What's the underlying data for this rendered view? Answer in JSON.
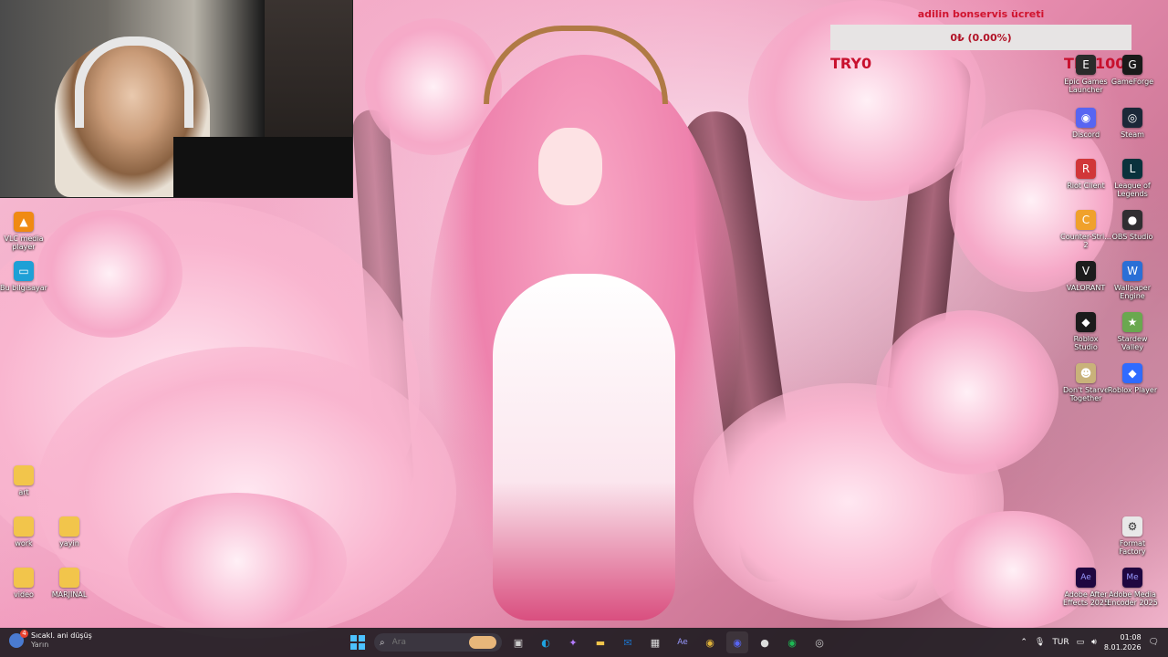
{
  "counter": {
    "title": "adilin bonservis ücreti",
    "value": "0₺ (0.00%)",
    "left_label": "TRY0",
    "right_label": "TRY1000"
  },
  "left_icons": [
    {
      "label": "VLC media\nplayer",
      "icon": "vlc-icon",
      "color": "#f08a12",
      "glyph": "▲"
    },
    {
      "label": "Bu bilgisayar",
      "icon": "computer-icon",
      "color": "#1ea0d6",
      "glyph": "▭"
    },
    {
      "label": "art",
      "icon": "folder-icon",
      "color": "#f2c54b",
      "glyph": ""
    },
    {
      "label": "work",
      "icon": "folder-icon",
      "color": "#f2c54b",
      "glyph": ""
    },
    {
      "label": "yayin",
      "icon": "folder-icon",
      "color": "#f2c54b",
      "glyph": ""
    },
    {
      "label": "video",
      "icon": "folder-icon",
      "color": "#f2c54b",
      "glyph": ""
    },
    {
      "label": "MARJINAL",
      "icon": "folder-icon",
      "color": "#f2c54b",
      "glyph": ""
    }
  ],
  "right_icons": [
    {
      "label": "Epic Games\nLauncher",
      "icon": "epic-games-icon",
      "color": "#2b2b2b",
      "glyph": "E"
    },
    {
      "label": "GameForge",
      "icon": "gameforge-icon",
      "color": "#1a1a1a",
      "glyph": "G"
    },
    {
      "label": "Discord",
      "icon": "discord-icon",
      "color": "#5865f2",
      "glyph": "◉"
    },
    {
      "label": "Steam",
      "icon": "steam-icon",
      "color": "#1b2838",
      "glyph": "◎"
    },
    {
      "label": "Riot Client",
      "icon": "riot-client-icon",
      "color": "#d13639",
      "glyph": "R"
    },
    {
      "label": "League of\nLegends",
      "icon": "league-of-legends-icon",
      "color": "#0a323c",
      "glyph": "L"
    },
    {
      "label": "Counter-Stri...\n2",
      "icon": "counter-strike-icon",
      "color": "#f0a12b",
      "glyph": "C"
    },
    {
      "label": "OBS Studio",
      "icon": "obs-icon",
      "color": "#302e31",
      "glyph": "●"
    },
    {
      "label": "VALORANT",
      "icon": "valorant-icon",
      "color": "#1c1c1c",
      "glyph": "V"
    },
    {
      "label": "Wallpaper\nEngine",
      "icon": "wallpaper-engine-icon",
      "color": "#2a6fd6",
      "glyph": "W"
    },
    {
      "label": "Roblox\nStudio",
      "icon": "roblox-studio-icon",
      "color": "#1b1b1b",
      "glyph": "◆"
    },
    {
      "label": "Stardew\nValley",
      "icon": "stardew-valley-icon",
      "color": "#6aa84f",
      "glyph": "★"
    },
    {
      "label": "Don't Starve\nTogether",
      "icon": "dont-starve-icon",
      "color": "#c9b27a",
      "glyph": "☻"
    },
    {
      "label": "Roblox Player",
      "icon": "roblox-player-icon",
      "color": "#2f6bff",
      "glyph": "◆"
    },
    {
      "label": "Format\nFactory",
      "icon": "format-factory-icon",
      "color": "#e8e8e8",
      "glyph": "⚙"
    },
    {
      "label": "Adobe After\nEffects 2025",
      "icon": "after-effects-icon",
      "color": "#1f0740",
      "glyph": "Ae"
    },
    {
      "label": "Adobe Media\nEncoder 2025",
      "icon": "media-encoder-icon",
      "color": "#1f0740",
      "glyph": "Me"
    }
  ],
  "taskbar": {
    "weather_title": "Sıcakl. ani düşüş",
    "weather_sub": "Yarın",
    "weather_badge": "4",
    "search_placeholder": "Ara",
    "apps": [
      {
        "name": "task-view",
        "glyph": "▣",
        "color": "#ccc"
      },
      {
        "name": "edge",
        "glyph": "◐",
        "color": "#1fa3e0"
      },
      {
        "name": "copilot",
        "glyph": "✦",
        "color": "#b57cff"
      },
      {
        "name": "file-explorer",
        "glyph": "▬",
        "color": "#f2c54b"
      },
      {
        "name": "outlook",
        "glyph": "✉",
        "color": "#1d73c9"
      },
      {
        "name": "store",
        "glyph": "▦",
        "color": "#ddd"
      },
      {
        "name": "after-effects",
        "glyph": "Ae",
        "color": "#9999ff"
      },
      {
        "name": "chrome",
        "glyph": "◉",
        "color": "#e0b33a"
      },
      {
        "name": "discord",
        "glyph": "◉",
        "color": "#5865f2"
      },
      {
        "name": "obs",
        "glyph": "●",
        "color": "#ddd"
      },
      {
        "name": "spotify",
        "glyph": "◉",
        "color": "#1db954"
      },
      {
        "name": "steam",
        "glyph": "◎",
        "color": "#ccc"
      }
    ],
    "language": "TUR",
    "time": "01:08",
    "date": "8.01.2026"
  }
}
